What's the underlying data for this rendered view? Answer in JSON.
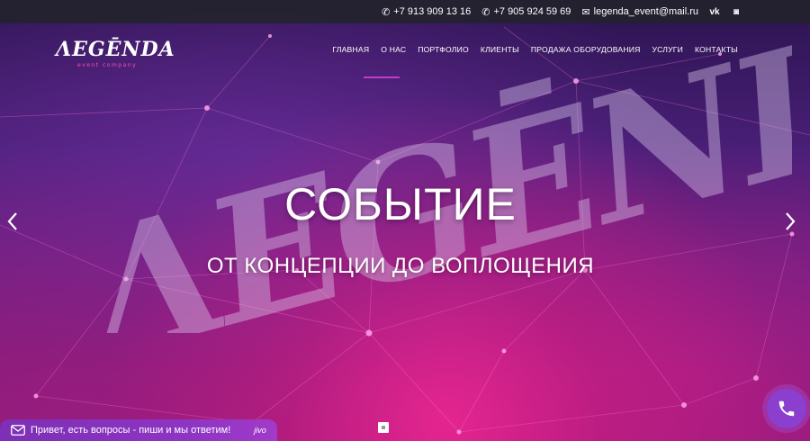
{
  "topbar": {
    "phone1": "+7 913 909 13 16",
    "phone2": "+7 905 924 59 69",
    "email": "legenda_event@mail.ru",
    "socials": [
      {
        "name": "vk-icon",
        "label": "vk"
      },
      {
        "name": "instagram-icon",
        "label": "ig"
      }
    ]
  },
  "logo": {
    "title": "ΛEGĒNDA",
    "subtitle": "event company"
  },
  "nav": {
    "items": [
      {
        "label": "ГЛАВНАЯ"
      },
      {
        "label": "О НАС"
      },
      {
        "label": "ПОРТФОЛИО"
      },
      {
        "label": "КЛИЕНТЫ"
      },
      {
        "label": "ПРОДАЖА ОБОРУДОВАНИЯ"
      },
      {
        "label": "УСЛУГИ"
      },
      {
        "label": "КОНТАКТЫ"
      }
    ]
  },
  "slide": {
    "title": "СОБЫТИЕ",
    "subtitle": "ОТ КОНЦЕПЦИИ ДО ВОПЛОЩЕНИЯ",
    "background_word": "ΛEGĒNDA"
  },
  "chat": {
    "text": "Привет, есть вопросы - пиши и мы ответим!",
    "brand": "jivo"
  },
  "colors": {
    "accent": "#c43bc4",
    "chat": "#8e35c4",
    "topbar": "#23232d"
  }
}
